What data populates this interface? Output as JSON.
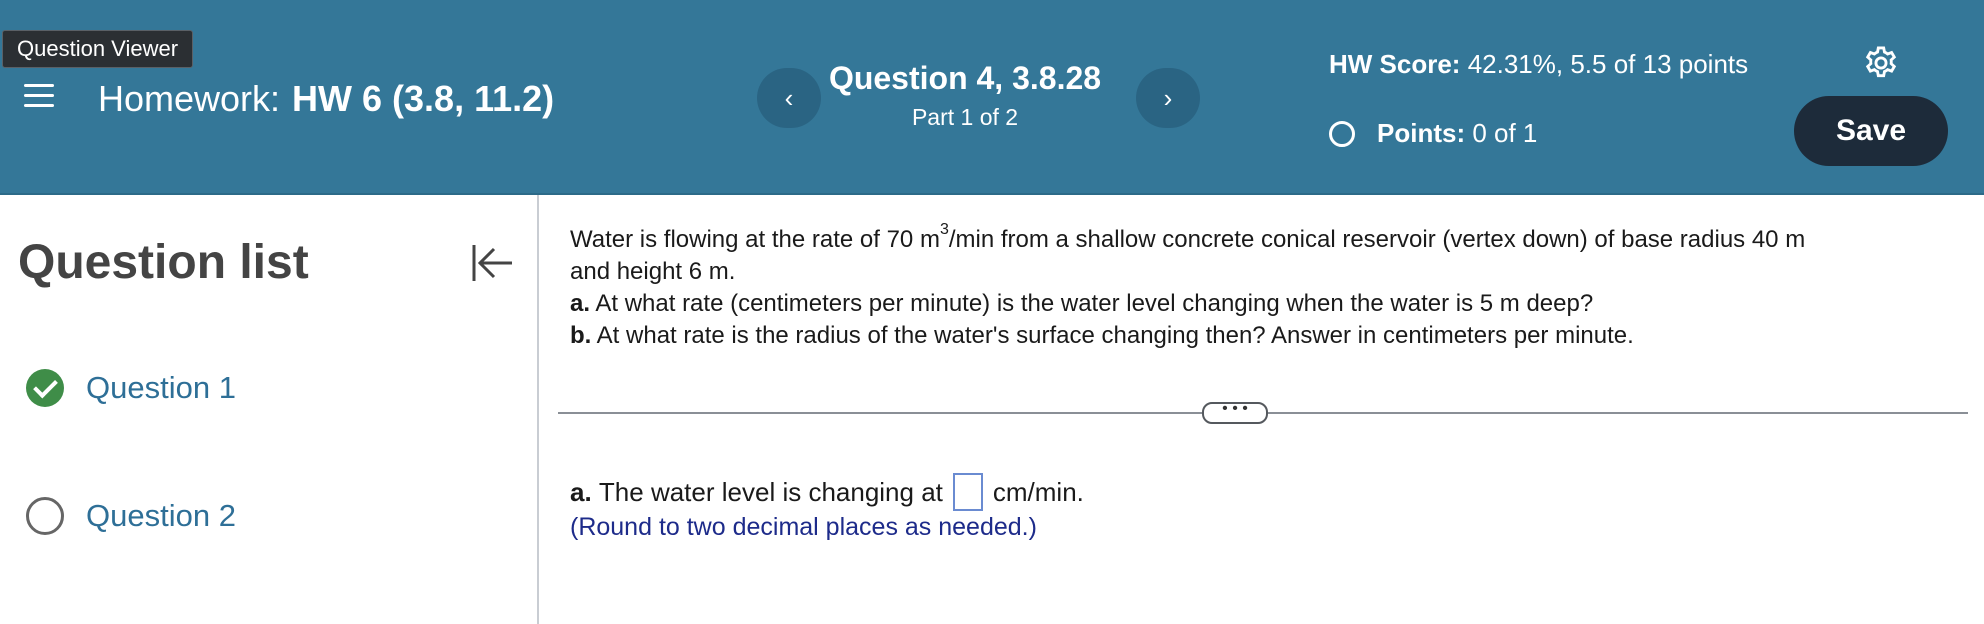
{
  "header": {
    "question_viewer_label": "Question Viewer",
    "homework_label": "Homework:",
    "homework_name": "HW 6 (3.8, 11.2)",
    "prev_arrow": "‹",
    "next_arrow": "›",
    "question_title": "Question 4, 3.8.28",
    "question_part": "Part 1 of 2",
    "score_label": "HW Score:",
    "score_value": "42.31%, 5.5 of 13 points",
    "points_label": "Points:",
    "points_value": "0 of 1",
    "save_label": "Save"
  },
  "sidebar": {
    "title": "Question list",
    "items": [
      {
        "label": "Question 1",
        "status": "correct"
      },
      {
        "label": "Question 2",
        "status": "unanswered"
      }
    ]
  },
  "question": {
    "line1_pre": "Water is flowing at the rate of 70 m",
    "line1_sup": "3",
    "line1_post": "/min from a shallow concrete conical reservoir (vertex down) of base radius 40 m",
    "line2": "and height 6 m.",
    "a_label": "a.",
    "a_text": "At what rate (centimeters per minute) is the water level changing when the water is 5 m deep?",
    "b_label": "b.",
    "b_text": "At what rate is the radius of the water's surface changing then? Answer in centimeters per minute."
  },
  "divider": {
    "more_label": "• • •"
  },
  "answer": {
    "a_label": "a.",
    "prefix": "The water level is changing at",
    "value": "",
    "unit": "cm/min.",
    "hint": "(Round to two decimal places as needed.)"
  },
  "colors": {
    "header_bg": "#347798",
    "save_bg": "#1d2b3a",
    "link": "#2e6f97",
    "correct": "#3f8d48",
    "hint": "#1d2b8a"
  }
}
